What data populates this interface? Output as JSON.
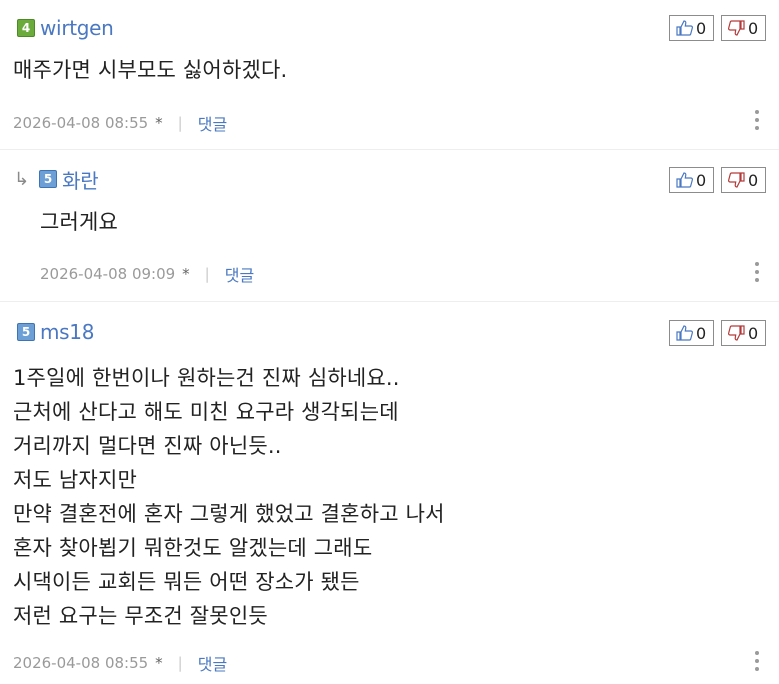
{
  "comments": [
    {
      "level": "4",
      "nickname": "wirtgen",
      "body": [
        "매주가면 시부모도 싫어하겠다."
      ],
      "likes": "0",
      "dislikes": "0",
      "datetime": "2026-04-08 08:55",
      "star": "*",
      "separator": "|",
      "reply_label": "댓글"
    },
    {
      "reply_arrow": "↳",
      "level": "5",
      "nickname": "화란",
      "body": [
        "그러게요"
      ],
      "likes": "0",
      "dislikes": "0",
      "datetime": "2026-04-08 09:09",
      "star": "*",
      "separator": "|",
      "reply_label": "댓글"
    },
    {
      "level": "5",
      "nickname": "ms18",
      "body": [
        "1주일에 한번이나 원하는건 진짜 심하네요..",
        "근처에 산다고 해도 미친 요구라 생각되는데",
        "거리까지 멀다면 진짜 아닌듯..",
        "저도 남자지만",
        "만약 결혼전에 혼자 그렇게 했었고 결혼하고 나서",
        "혼자 찾아뵙기 뭐한것도 알겠는데 그래도",
        "시댁이든 교회든 뭐든 어떤 장소가 됐든",
        "저런 요구는 무조건 잘못인듯"
      ],
      "likes": "0",
      "dislikes": "0",
      "datetime": "2026-04-08 08:55",
      "star": "*",
      "separator": "|",
      "reply_label": "댓글"
    }
  ],
  "colors": {
    "nickname": "#4a78c2",
    "level_green": "#6aab3c",
    "level_blue": "#6b9fd6",
    "like_icon": "#4a78c2",
    "dislike_icon": "#b33a3a",
    "meta_text": "#9a9a9a"
  },
  "icons": {
    "like": "thumbs-up-icon",
    "dislike": "thumbs-down-icon",
    "more": "kebab-menu-icon",
    "reply": "reply-arrow-icon"
  }
}
